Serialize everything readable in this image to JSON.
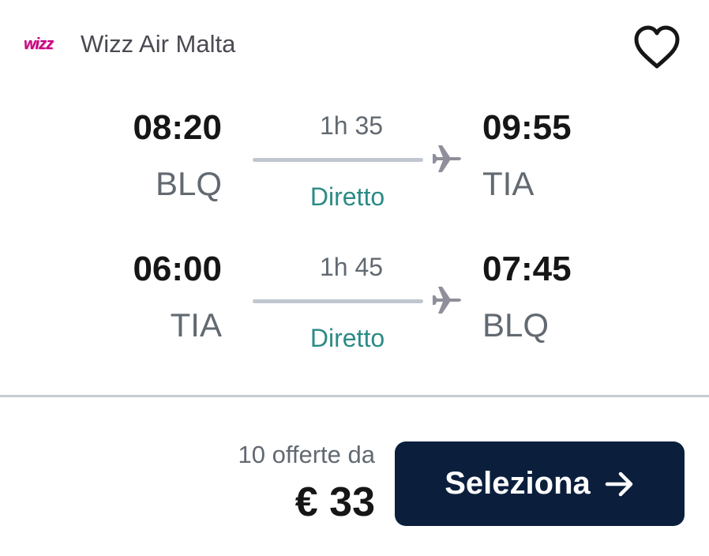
{
  "airline": {
    "logo_text": "wizz",
    "name": "Wizz Air Malta"
  },
  "favorite": {
    "icon": "heart-icon"
  },
  "legs": [
    {
      "dep_time": "08:20",
      "dep_airport": "BLQ",
      "duration": "1h 35",
      "stops": "Diretto",
      "arr_time": "09:55",
      "arr_airport": "TIA"
    },
    {
      "dep_time": "06:00",
      "dep_airport": "TIA",
      "duration": "1h 45",
      "stops": "Diretto",
      "arr_time": "07:45",
      "arr_airport": "BLQ"
    }
  ],
  "pricing": {
    "offers": "10 offerte da",
    "price": "€ 33"
  },
  "select_button": {
    "label": "Seleziona",
    "icon": "arrow-right-icon"
  },
  "colors": {
    "button_bg": "#0b1f3d",
    "stops_text": "#2b8b86",
    "accent_logo": "#c6007e"
  }
}
